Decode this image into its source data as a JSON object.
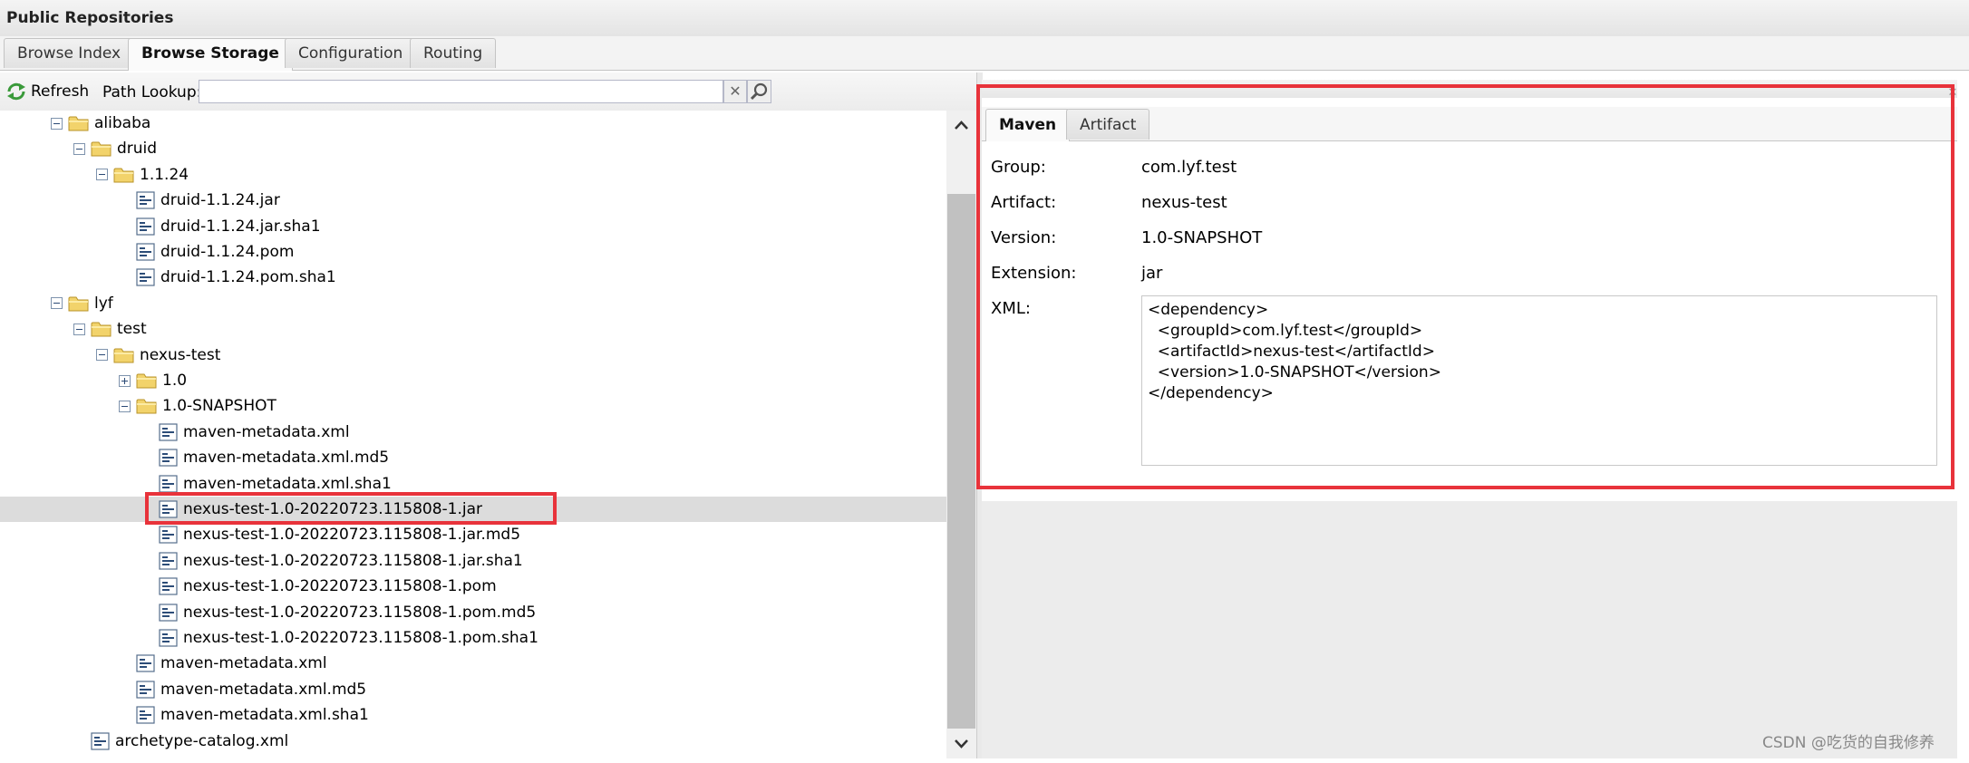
{
  "window": {
    "title": "Public Repositories"
  },
  "tabs": [
    {
      "label": "Browse Index",
      "active": false
    },
    {
      "label": "Browse Storage",
      "active": true
    },
    {
      "label": "Configuration",
      "active": false
    },
    {
      "label": "Routing",
      "active": false
    }
  ],
  "toolbar": {
    "refresh_label": "Refresh",
    "path_lookup_label": "Path Lookup:",
    "path_lookup_value": ""
  },
  "tree": [
    {
      "label": "alibaba",
      "type": "folder",
      "state": "expanded",
      "depth": 0
    },
    {
      "label": "druid",
      "type": "folder",
      "state": "expanded",
      "depth": 1
    },
    {
      "label": "1.1.24",
      "type": "folder",
      "state": "expanded",
      "depth": 2
    },
    {
      "label": "druid-1.1.24.jar",
      "type": "file",
      "depth": 3
    },
    {
      "label": "druid-1.1.24.jar.sha1",
      "type": "file",
      "depth": 3
    },
    {
      "label": "druid-1.1.24.pom",
      "type": "file",
      "depth": 3
    },
    {
      "label": "druid-1.1.24.pom.sha1",
      "type": "file",
      "depth": 3
    },
    {
      "label": "lyf",
      "type": "folder",
      "state": "expanded",
      "depth": 0
    },
    {
      "label": "test",
      "type": "folder",
      "state": "expanded",
      "depth": 1
    },
    {
      "label": "nexus-test",
      "type": "folder",
      "state": "expanded",
      "depth": 2
    },
    {
      "label": "1.0",
      "type": "folder",
      "state": "collapsed",
      "depth": 3
    },
    {
      "label": "1.0-SNAPSHOT",
      "type": "folder",
      "state": "expanded",
      "depth": 3
    },
    {
      "label": "maven-metadata.xml",
      "type": "file",
      "depth": 4
    },
    {
      "label": "maven-metadata.xml.md5",
      "type": "file",
      "depth": 4
    },
    {
      "label": "maven-metadata.xml.sha1",
      "type": "file",
      "depth": 4
    },
    {
      "label": "nexus-test-1.0-20220723.115808-1.jar",
      "type": "file",
      "depth": 4,
      "selected": true
    },
    {
      "label": "nexus-test-1.0-20220723.115808-1.jar.md5",
      "type": "file",
      "depth": 4
    },
    {
      "label": "nexus-test-1.0-20220723.115808-1.jar.sha1",
      "type": "file",
      "depth": 4
    },
    {
      "label": "nexus-test-1.0-20220723.115808-1.pom",
      "type": "file",
      "depth": 4
    },
    {
      "label": "nexus-test-1.0-20220723.115808-1.pom.md5",
      "type": "file",
      "depth": 4
    },
    {
      "label": "nexus-test-1.0-20220723.115808-1.pom.sha1",
      "type": "file",
      "depth": 4
    },
    {
      "label": "maven-metadata.xml",
      "type": "file",
      "depth": 3
    },
    {
      "label": "maven-metadata.xml.md5",
      "type": "file",
      "depth": 3
    },
    {
      "label": "maven-metadata.xml.sha1",
      "type": "file",
      "depth": 3
    },
    {
      "label": "archetype-catalog.xml",
      "type": "file",
      "depth": 1
    }
  ],
  "detail": {
    "tabs": [
      {
        "label": "Maven",
        "active": true
      },
      {
        "label": "Artifact",
        "active": false
      }
    ],
    "fields": [
      {
        "label": "Group:",
        "value": "com.lyf.test"
      },
      {
        "label": "Artifact:",
        "value": "nexus-test"
      },
      {
        "label": "Version:",
        "value": "1.0-SNAPSHOT"
      },
      {
        "label": "Extension:",
        "value": "jar"
      }
    ],
    "xml_label": "XML:",
    "xml": "<dependency>\n  <groupId>com.lyf.test</groupId>\n  <artifactId>nexus-test</artifactId>\n  <version>1.0-SNAPSHOT</version>\n</dependency>"
  },
  "colors": {
    "highlight_box": "#e8333b",
    "selected_row": "#dcdcdc",
    "folder": "#f2d36b"
  },
  "icons": {
    "refresh": "refresh-icon",
    "clear": "clear-icon",
    "search": "search-icon",
    "folder": "folder-icon",
    "file": "file-icon",
    "expand": "expand-toggle",
    "collapse": "collapse-toggle",
    "scroll_up": "chevron-up-icon",
    "scroll_down": "chevron-down-icon",
    "close": "close-icon"
  },
  "watermark": "CSDN @吃货的自我修养"
}
